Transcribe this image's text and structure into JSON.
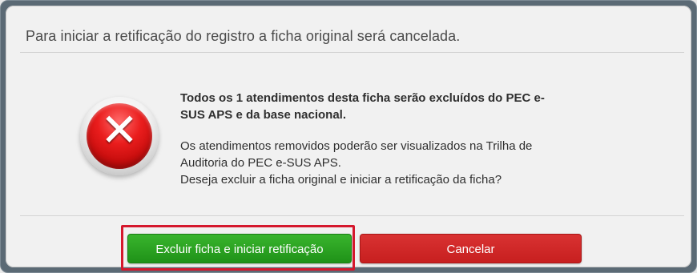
{
  "dialog": {
    "title": "Para iniciar a retificação do registro a ficha original será cancelada.",
    "icon": "error-icon",
    "message": {
      "bold_line_1": "Todos os 1 atendimentos desta ficha serão excluídos do PEC e-",
      "bold_line_2": "SUS APS e da base nacional.",
      "line_3": "Os atendimentos removidos poderão ser visualizados na Trilha de",
      "line_4": "Auditoria do PEC e-SUS APS.",
      "line_5": "Deseja excluir a ficha original e iniciar a retificação da ficha?"
    },
    "buttons": {
      "confirm_label": "Excluir ficha e iniciar retificação",
      "cancel_label": "Cancelar"
    }
  },
  "colors": {
    "confirm_button": "#2fa426",
    "cancel_button": "#cf2323",
    "highlight_border": "#d5182d",
    "error_icon": "#d71b1b"
  }
}
